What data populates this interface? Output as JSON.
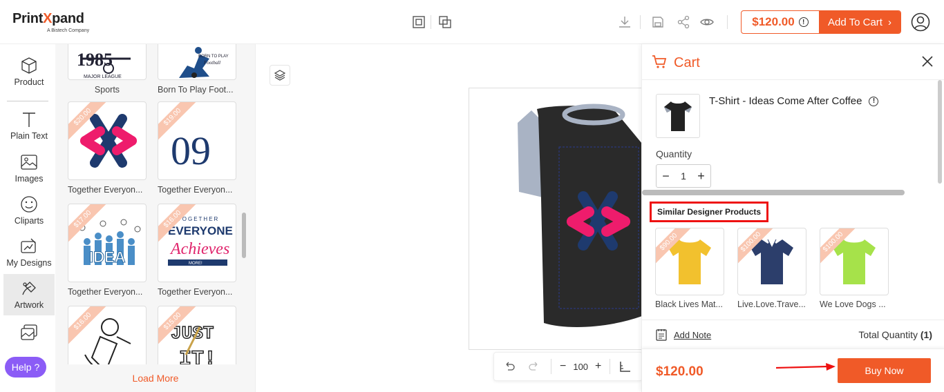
{
  "header": {
    "logo_prefix": "Print",
    "logo_x": "X",
    "logo_suffix": "pand",
    "logo_sub": "A Bistech Company",
    "price": "$120.00",
    "add_to_cart": "Add To Cart",
    "icons": [
      "grid-icon",
      "copy-icon",
      "download-icon",
      "save-icon",
      "share-icon",
      "preview-eye-icon",
      "user-icon"
    ]
  },
  "leftnav": {
    "items": [
      {
        "label": "Product",
        "icon": "cube-icon"
      },
      {
        "label": "Plain Text",
        "icon": "text-icon"
      },
      {
        "label": "Images",
        "icon": "image-icon"
      },
      {
        "label": "Cliparts",
        "icon": "smiley-icon"
      },
      {
        "label": "My Designs",
        "icon": "my-designs-icon"
      },
      {
        "label": "Artwork",
        "icon": "artwork-icon"
      },
      {
        "label": "",
        "icon": "gallery-icon"
      }
    ],
    "help": "Help ?"
  },
  "artwork": {
    "items": [
      {
        "label": "Sports",
        "price": ""
      },
      {
        "label": "Born To Play Foot...",
        "price": ""
      },
      {
        "label": "Together Everyon...",
        "price": "$20.00"
      },
      {
        "label": "Together Everyon...",
        "price": "$19.00"
      },
      {
        "label": "Together Everyon...",
        "price": "$17.00"
      },
      {
        "label": "Together Everyon...",
        "price": "$16.00"
      },
      {
        "label": "",
        "price": "$16.00"
      },
      {
        "label": "",
        "price": "$15.00"
      }
    ],
    "load_more": "Load More"
  },
  "canvas": {
    "zoom": "100",
    "zoom_minus": "−",
    "zoom_plus": "+"
  },
  "cart": {
    "title": "Cart",
    "product_name": "T-Shirt - Ideas Come After Coffee",
    "quantity_label": "Quantity",
    "quantity": "1",
    "similar_title": "Similar Designer Products",
    "similar": [
      {
        "label": "Black Lives Mat...",
        "price": "$90.00",
        "color": "#f2c12e"
      },
      {
        "label": "Live.Love.Trave...",
        "price": "$100.00",
        "color": "#2c3e6b"
      },
      {
        "label": "We Love Dogs ...",
        "price": "$100.00",
        "color": "#a6e24a"
      }
    ],
    "add_note": "Add Note",
    "total_quantity_label": "Total Quantity",
    "total_quantity": "(1)",
    "total_price": "$120.00",
    "buy_now": "Buy Now"
  },
  "colors": {
    "accent": "#f05a28",
    "help": "#8b5cf6",
    "highlight": "#e11111"
  }
}
